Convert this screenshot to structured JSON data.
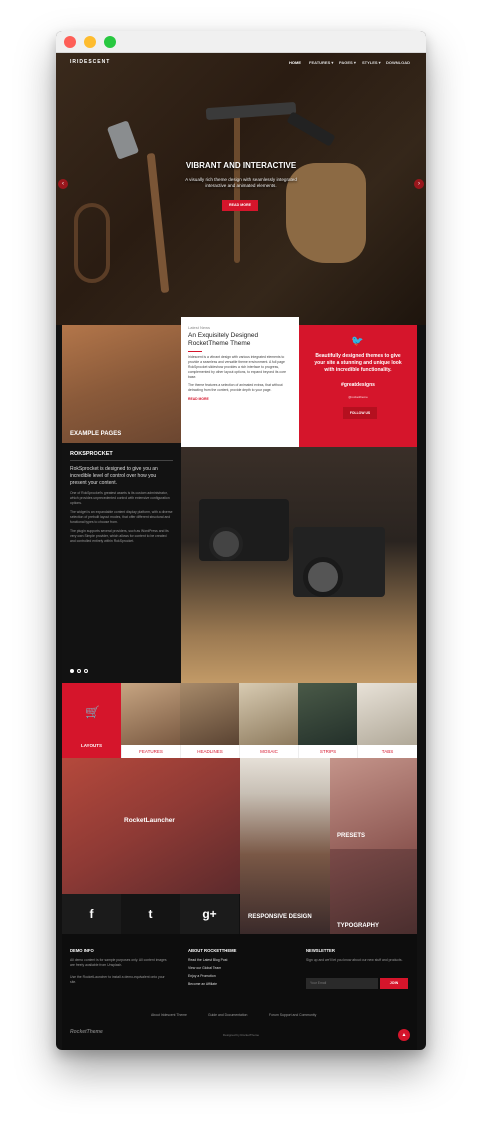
{
  "nav": {
    "logo": "IRIDESCENT",
    "items": [
      "HOME",
      "FEATURES ▾",
      "PAGES ▾",
      "STYLES ▾",
      "DOWNLOAD"
    ]
  },
  "hero": {
    "title": "VIBRANT AND INTERACTIVE",
    "text": "A visually rich theme design with seamlessly integrated interactive and animated elements.",
    "button": "READ MORE"
  },
  "example_pages": "EXAMPLE PAGES",
  "news": {
    "kicker": "Latest News",
    "title": "An Exquisitely Designed RocketTheme Theme",
    "p1": "Iridescent is a vibrant design with various integrated elements to provide a seamless and versatile theme environment. A full page RokSprocket slideshow provides a rich interface to progress, complemented by other layout options, to expand beyond its core base.",
    "p2": "The theme features a selection of animated extras, that without detracting from the content, provide depth to your page.",
    "more": "READ MORE"
  },
  "social": {
    "text": "Beautifully designed themes to give your site a stunning and unique look with incredible functionality.",
    "tag": "#greatdesigns",
    "handle": "@rockettheme",
    "button": "FOLLOW US"
  },
  "roksprocket": {
    "title": "ROKSPROCKET",
    "lead": "RokSprocket is designed to give you an incredible level of control over how you present your content.",
    "p1": "One of RokSprocket's greatest assets is its custom administrator, which provides unprecedented control with extensive configuration options.",
    "p2": "The widget is an expandable content display platform, with a diverse selection of prebuilt layout modes, that offer different structural and functional types to choose from.",
    "p3": "The plugin supports several providers, such as WordPress and its very own Simple provider, which allows for content to be created and controlled entirely within RokSprocket."
  },
  "features": {
    "labels": [
      "LAYOUTS",
      "FEATURES",
      "HEADLINES",
      "MOSAIC",
      "STRIPS",
      "TABS"
    ]
  },
  "mosaic": {
    "rocketlauncher": "RocketLauncher",
    "responsive": "RESPONSIVE DESIGN",
    "presets": "PRESETS",
    "typography": "TYPOGRAPHY",
    "social_icons": [
      "f",
      "t",
      "g+"
    ]
  },
  "footer": {
    "demo_title": "DEMO INFO",
    "demo_text1": "All demo content is for sample purposes only. All content images are freely available from Unsplash.",
    "demo_text2": "Use the RocketLauncher to install a demo-equivalent onto your site.",
    "about_title": "ABOUT ROCKETTHEME",
    "about_links": [
      "Read the Latest Blog Post",
      "View our Global Team",
      "Enjoy a Promotion",
      "Become an Affiliate"
    ],
    "news_title": "NEWSLETTER",
    "news_text": "Sign up and we'll let you know about our new stuff and products.",
    "email_placeholder": "Your Email",
    "join": "JOIN",
    "bottom_links": [
      "About Iridescent Theme",
      "Guide and Documentation",
      "Forum Support and Community"
    ],
    "brand": "RocketTheme",
    "designed": "Designed by RocketTheme",
    "to_top": "▲"
  },
  "colors": {
    "accent": "#d5152b",
    "dark": "#121212"
  }
}
